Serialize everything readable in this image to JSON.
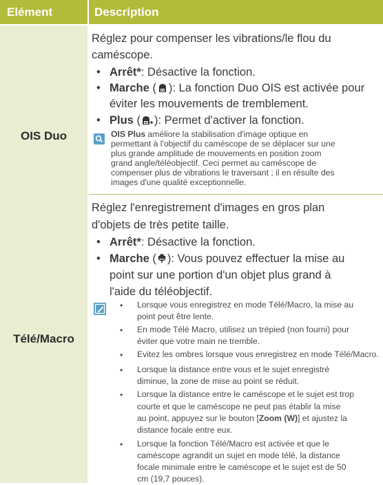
{
  "header": {
    "col1": "Elément",
    "col2": "Description"
  },
  "row1": {
    "label": "OIS Duo",
    "intro1": "Réglez pour compenser les vibrations/le flou du",
    "intro2": "caméscope.",
    "b1_bold": "Arrêt*",
    "b1_text": ": Désactive la fonction.",
    "b2_bold": "Marche",
    "b2_pre": " (",
    "b2_text1": "): La fonction Duo OIS est activée pour",
    "b2_text2": "éviter les mouvements de tremblement.",
    "b3_bold": "Plus",
    "b3_pre": " (",
    "b3_text": "): Permet d'activer la fonction.",
    "note_bold": "OIS Plus",
    "note_l1": " améliore la stabilisation d'image optique en",
    "note_l2": "permettant à l'objectif du caméscope de se déplacer sur une",
    "note_l3": "plus grande amplitude de mouvements en position zoom",
    "note_l4": "grand angle/téléobjectif. Ceci permet au caméscope de",
    "note_l5": "compenser plus de vibrations le traversant ; il en résulte des",
    "note_l6": "images d'une qualité exceptionnelle."
  },
  "row2": {
    "label": "Télé/Macro",
    "intro1": "Réglez l'enregistrement d'images en gros plan",
    "intro2": "d'objets de très petite taille.",
    "b1_bold": "Arrêt*",
    "b1_text": ": Désactive la fonction.",
    "b2_bold": "Marche",
    "b2_pre": " (",
    "b2_text1": "): Vous pouvez effectuer la mise au",
    "b2_text2": "point sur une portion d'un objet plus grand à",
    "b2_text3": "l'aide du téléobjectif.",
    "notes": {
      "n1_l1": "Lorsque vous enregistrez en mode Télé/Macro, la mise au",
      "n1_l2": "point peut être lente.",
      "n2_l1": "En mode Télé Macro, utilisez un trépied (non fourni) pour",
      "n2_l2": "éviter que votre main ne tremble.",
      "n3_l1": "Evitez les ombres lorsque vous enregistrez en mode Télé/Macro.",
      "n4_l1": "Lorsque la distance entre vous et le sujet enregistré",
      "n4_l2": "diminue, la zone de mise au point se réduit.",
      "n5_l1": "Lorsque la distance entre le caméscope et le sujet est trop",
      "n5_l2": "courte et que le caméscope ne peut pas établir la mise",
      "n5_l3a": "au point, appuyez sur le bouton [",
      "n5_l3b": "Zoom (W)",
      "n5_l3c": "] et ajustez la",
      "n5_l4": "distance focale entre eux.",
      "n6_l1": "Lorsque la fonction Télé/Macro est activée et que le",
      "n6_l2": "caméscope agrandit un sujet en mode télé, la distance",
      "n6_l3": "focale minimale entre le caméscope et le sujet est de 50",
      "n6_l4": "cm (19,7 pouces)."
    }
  },
  "bullet_glyph": "•",
  "colors": {
    "header": "#b3bb3a",
    "label_cell": "#eaedd2",
    "note_icon": "#5aa0c8",
    "rule": "#b9be70"
  },
  "icons": {
    "note1": "magnifier-note-icon",
    "note2": "pencil-note-icon",
    "ois_on": "hand-stabilizer-icon",
    "ois_plus": "hand-stabilizer-plus-icon",
    "macro": "flower-macro-icon"
  }
}
